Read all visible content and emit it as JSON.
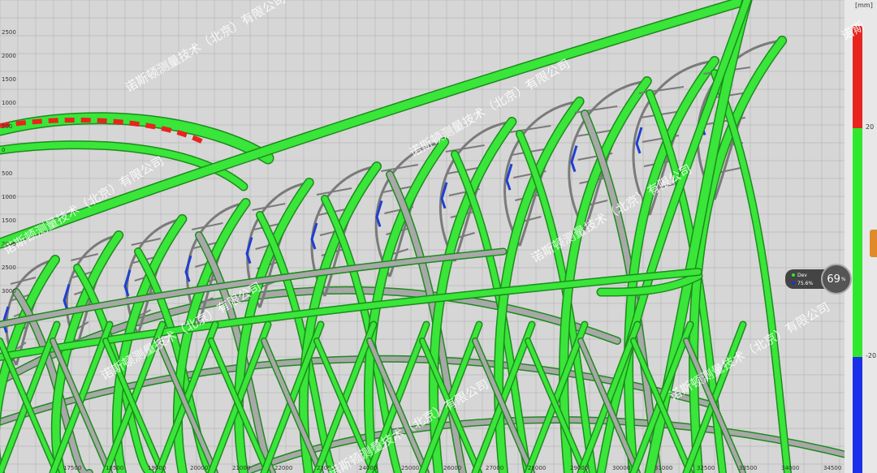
{
  "app": {
    "view": "deviation-color-map"
  },
  "axis": {
    "y_ticks": [
      "2500",
      "2000",
      "1500",
      "1000",
      "500",
      "0",
      "500",
      "1000",
      "1500",
      "2000",
      "2500",
      "3000"
    ],
    "x_ticks": [
      "17500",
      "18500",
      "19000",
      "20000",
      "21000",
      "22000",
      "23000",
      "24000",
      "25000",
      "26000",
      "27000",
      "28000",
      "29000",
      "30000",
      "31000",
      "32500",
      "33500",
      "34000",
      "34500"
    ]
  },
  "legend": {
    "unit": "[mm]",
    "ticks": [
      "20",
      "-20"
    ],
    "colors": {
      "high": "#e8241e",
      "ok": "#2ee82e",
      "low": "#1a2fe8"
    },
    "watermark_side": "诺斯"
  },
  "watermark": {
    "text": "诺斯顿测量技术（北京）有限公司"
  },
  "stats": {
    "row1_label": "Dev",
    "row2_label": "75.6%",
    "gauge_value": "69",
    "gauge_unit": "%"
  },
  "colors": {
    "member_ok": "#39e639",
    "member_outline": "#1e8a1e",
    "member_gray": "#a8a8a8",
    "member_blue": "#1f3fd1",
    "member_red": "#e8241e",
    "panel": "#7a7a7a"
  }
}
